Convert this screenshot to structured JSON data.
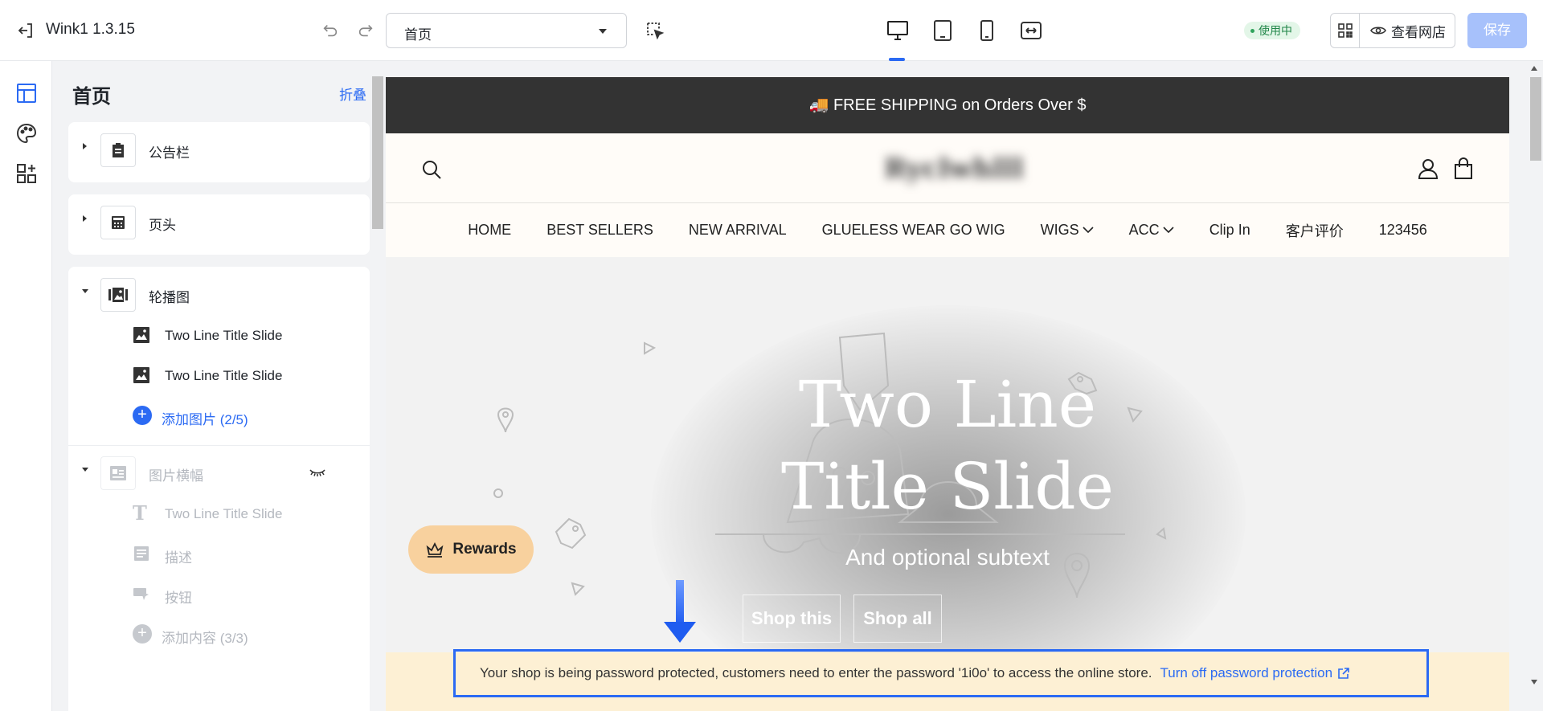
{
  "topbar": {
    "app_title": "Wink1 1.3.15",
    "page_select_value": "首页",
    "status_badge": "使用中",
    "view_store_label": "查看网店",
    "save_label": "保存"
  },
  "panel": {
    "title": "首页",
    "collapse_label": "折叠",
    "sections": [
      {
        "label": "公告栏",
        "icon": "clipboard-icon"
      },
      {
        "label": "页头",
        "icon": "header-icon"
      },
      {
        "label": "轮播图",
        "icon": "slideshow-icon",
        "items": [
          "Two Line Title Slide",
          "Two Line Title Slide"
        ],
        "add_label": "添加图片 (2/5)"
      },
      {
        "label": "图片横幅",
        "icon": "image-banner-icon",
        "items": [
          "Two Line Title Slide",
          "描述",
          "按钮"
        ],
        "add_label": "添加内容 (3/3)"
      }
    ]
  },
  "preview": {
    "announcement": "🚚 FREE SHIPPING on Orders Over $",
    "logo_text": "Ryclwhlll",
    "nav": [
      "HOME",
      "BEST SELLERS",
      "NEW ARRIVAL",
      "GLUELESS WEAR GO WIG",
      "WIGS",
      "ACC",
      "Clip In",
      "客户评价",
      "123456"
    ],
    "hero": {
      "title_line1": "Two Line",
      "title_line2": "Title Slide",
      "subtitle": "And optional subtext",
      "button1": "Shop this",
      "button2": "Shop all"
    },
    "rewards_label": "Rewards",
    "password_notice": "Your shop is being password protected, customers need to enter the password '1i0o' to access the online store.",
    "password_link": "Turn off password protection"
  },
  "colors": {
    "accent": "#2b6af3",
    "save_disabled": "#a7c1fb",
    "announcement_bg": "#333333",
    "rewards_bg": "#f8d19e",
    "password_banner_bg": "#fdf0d4"
  }
}
